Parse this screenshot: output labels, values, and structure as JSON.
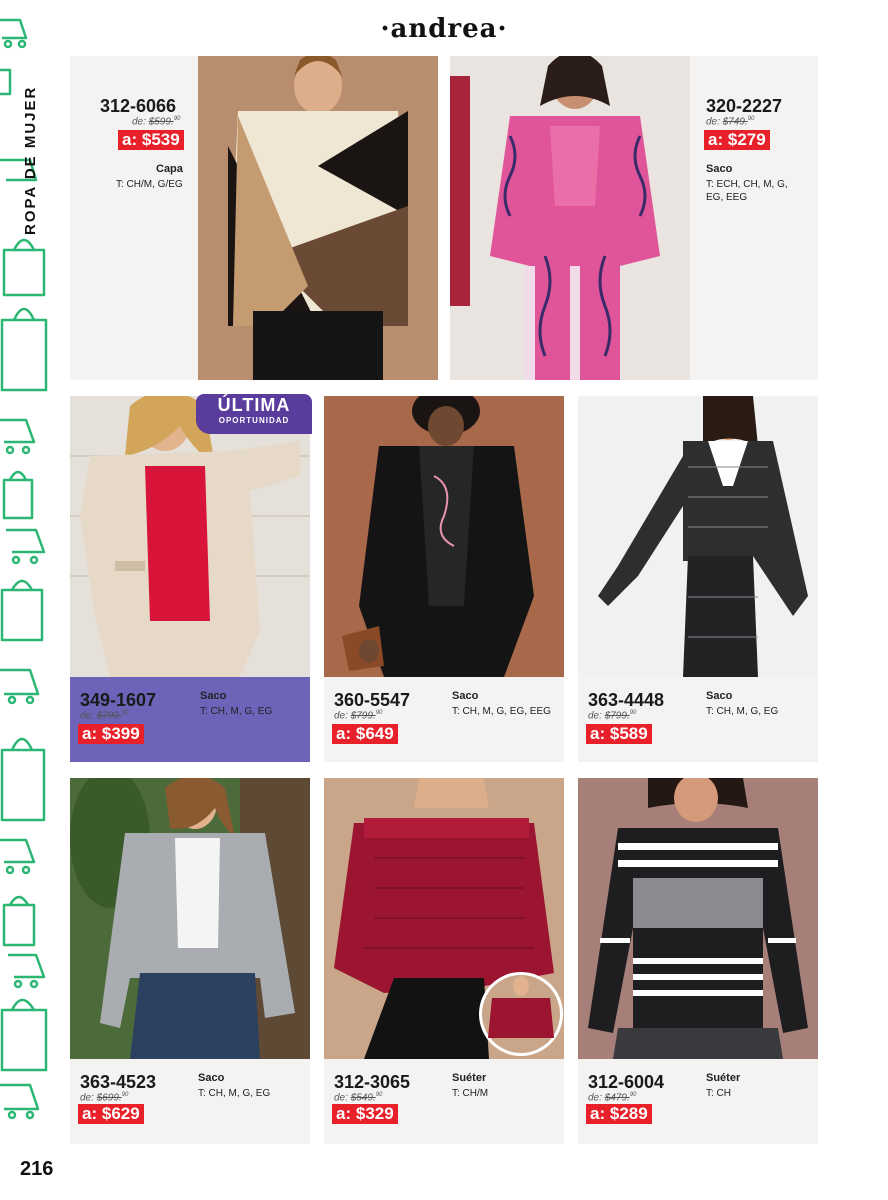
{
  "brand": "·andrea·",
  "section_title": "ROPA DE MUJER",
  "page_number": "216",
  "badge": {
    "line1": "ÚLTIMA",
    "line2": "OPORTUNIDAD"
  },
  "colors": {
    "accent": "#e8202a",
    "purple": "#6c64b8",
    "pattern": "#2bb673"
  },
  "products": [
    {
      "code": "312-6066",
      "was_label": "de:",
      "was_price": "$599.",
      "was_cents": "90",
      "now_label": "a:",
      "now_price": "$539",
      "type": "Capa",
      "sizes": "T: CH/M, G/EG"
    },
    {
      "code": "320-2227",
      "was_label": "de:",
      "was_price": "$749.",
      "was_cents": "90",
      "now_label": "a:",
      "now_price": "$279",
      "type": "Saco",
      "sizes": "T: ECH, CH, M, G, EG, EEG"
    },
    {
      "code": "349-1607",
      "was_label": "de:",
      "was_price": "$799.",
      "was_cents": "90",
      "now_label": "a:",
      "now_price": "$399",
      "type": "Saco",
      "sizes": "T: CH, M, G, EG"
    },
    {
      "code": "360-5547",
      "was_label": "de:",
      "was_price": "$799.",
      "was_cents": "90",
      "now_label": "a:",
      "now_price": "$649",
      "type": "Saco",
      "sizes": "T: CH, M, G, EG, EEG"
    },
    {
      "code": "363-4448",
      "was_label": "de:",
      "was_price": "$799.",
      "was_cents": "90",
      "now_label": "a:",
      "now_price": "$589",
      "type": "Saco",
      "sizes": "T: CH, M, G, EG"
    },
    {
      "code": "363-4523",
      "was_label": "de:",
      "was_price": "$699.",
      "was_cents": "90",
      "now_label": "a:",
      "now_price": "$629",
      "type": "Saco",
      "sizes": "T: CH, M, G, EG"
    },
    {
      "code": "312-3065",
      "was_label": "de:",
      "was_price": "$549.",
      "was_cents": "90",
      "now_label": "a:",
      "now_price": "$329",
      "type": "Suéter",
      "sizes": "T: CH/M"
    },
    {
      "code": "312-6004",
      "was_label": "de:",
      "was_price": "$479.",
      "was_cents": "90",
      "now_label": "a:",
      "now_price": "$289",
      "type": "Suéter",
      "sizes": "T: CH"
    }
  ]
}
